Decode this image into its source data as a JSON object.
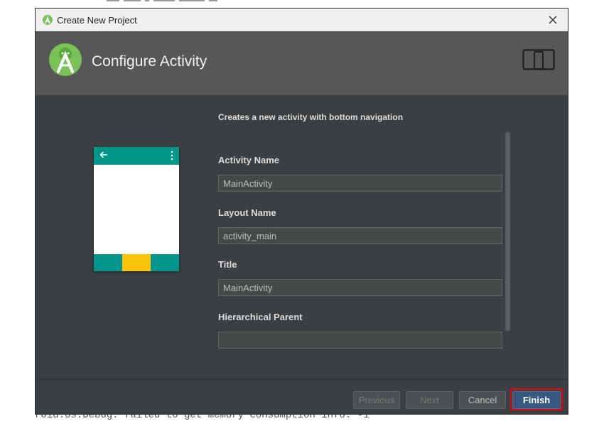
{
  "backdrop": {
    "console_line": "roid.os.Debug: failed to get memory consumption info: -1"
  },
  "window": {
    "title": "Create New Project",
    "icons": {
      "app": "android-studio-icon",
      "close": "close-icon"
    }
  },
  "header": {
    "heading": "Configure Activity",
    "icons": {
      "logo": "android-studio-logo",
      "form_factor": "phone-tablet-icon"
    }
  },
  "content": {
    "description": "Creates a new activity with bottom navigation",
    "preview": {
      "icons": {
        "back": "back-arrow-icon",
        "overflow": "overflow-menu-icon"
      },
      "colors": {
        "appbar": "#00968a",
        "bottom_nav": "#00968a",
        "selected_tab": "#fcc30b"
      }
    },
    "fields": [
      {
        "label": "Activity Name",
        "value": "MainActivity"
      },
      {
        "label": "Layout Name",
        "value": "activity_main"
      },
      {
        "label": "Title",
        "value": "MainActivity"
      },
      {
        "label": "Hierarchical Parent",
        "value": ""
      }
    ]
  },
  "footer": {
    "previous_label": "Previous",
    "next_label": "Next",
    "cancel_label": "Cancel",
    "finish_label": "Finish",
    "highlight_color": "#e8000b"
  }
}
